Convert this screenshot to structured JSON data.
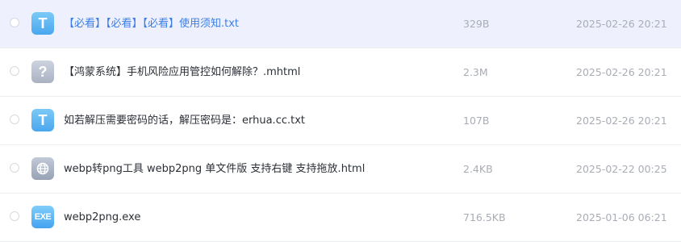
{
  "files": [
    {
      "name": "【必看】【必看】【必看】使用须知.txt",
      "size": "329B",
      "date": "2025-02-26 20:21",
      "icon": "txt-file-icon",
      "icon_glyph": "T"
    },
    {
      "name": "【鸿蒙系统】手机风险应用管控如何解除？.mhtml",
      "size": "2.3M",
      "date": "2025-02-26 20:21",
      "icon": "unknown-file-icon",
      "icon_glyph": "?"
    },
    {
      "name": "如若解压需要密码的话，解压密码是：erhua.cc.txt",
      "size": "107B",
      "date": "2025-02-26 20:21",
      "icon": "txt-file-icon",
      "icon_glyph": "T"
    },
    {
      "name": "webp转png工具 webp2png 单文件版 支持右键 支持拖放.html",
      "size": "2.4KB",
      "date": "2025-02-22 00:25",
      "icon": "html-file-icon",
      "icon_glyph": ""
    },
    {
      "name": "webp2png.exe",
      "size": "716.5KB",
      "date": "2025-01-06 06:21",
      "icon": "exe-file-icon",
      "icon_glyph": "EXE"
    }
  ],
  "colors": {
    "link": "#3d7ee6",
    "highlight_row": "#eef1fd",
    "meta_text": "#a9adb5"
  }
}
